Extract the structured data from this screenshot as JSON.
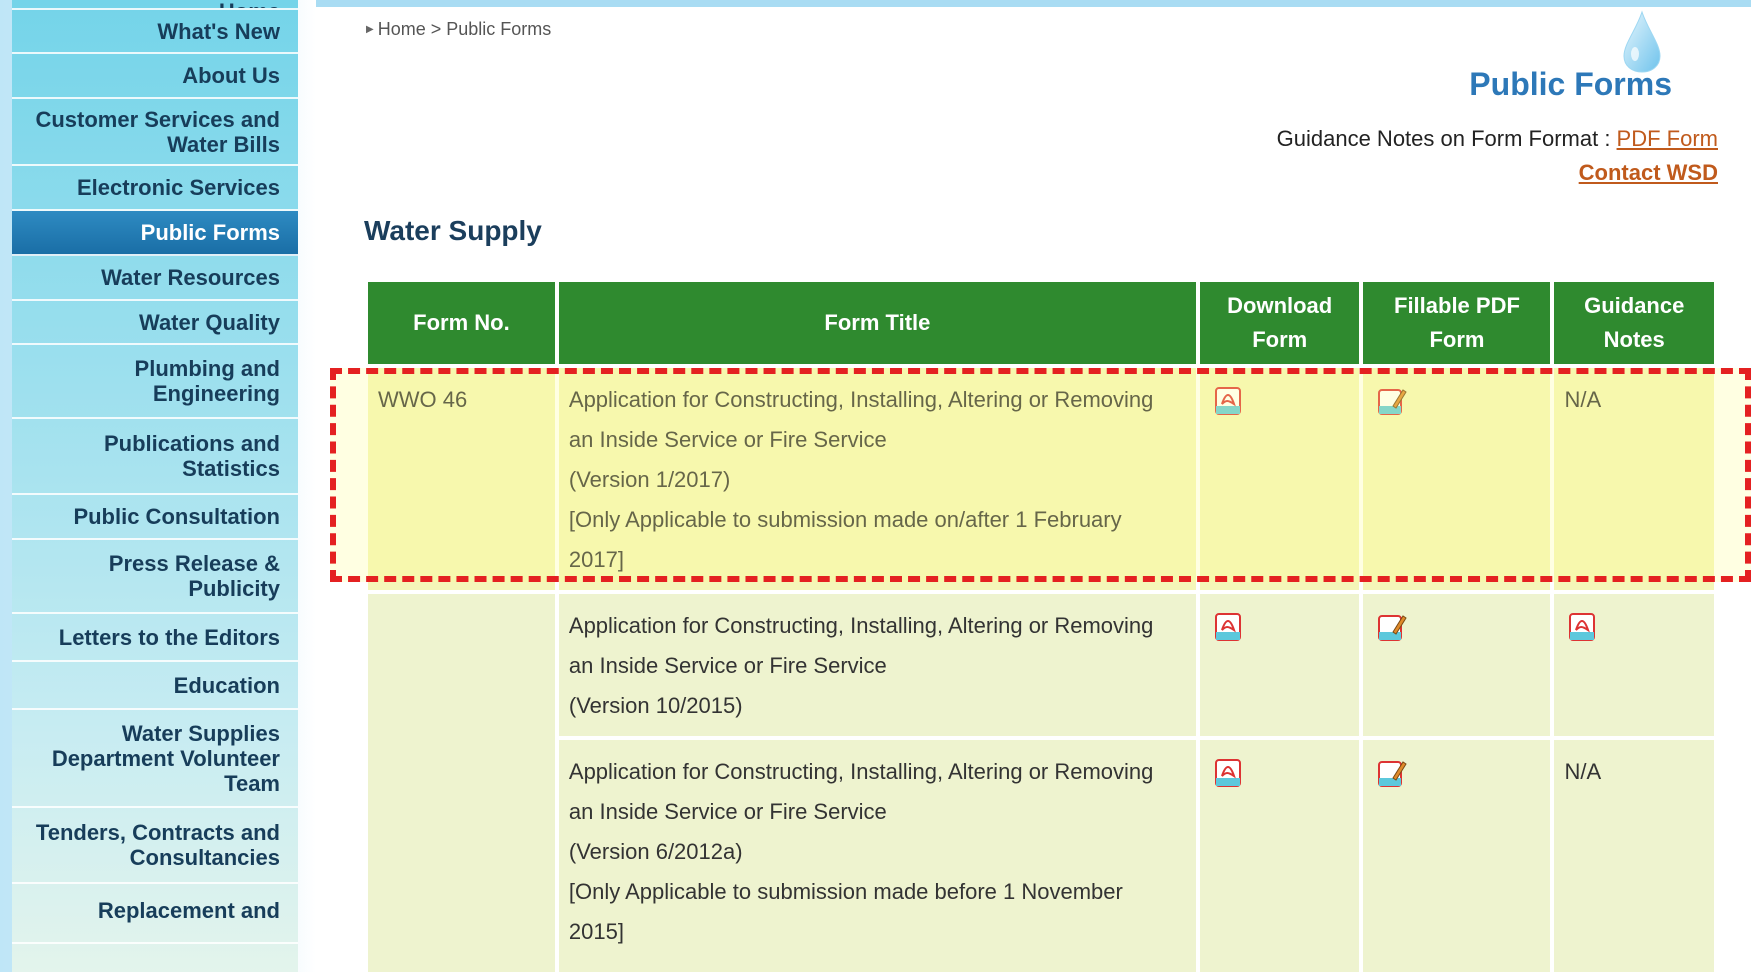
{
  "breadcrumb": {
    "home": "Home",
    "separator": ">",
    "current": "Public Forms"
  },
  "page_title": "Public Forms",
  "guidance": {
    "label": "Guidance Notes on Form Format : ",
    "pdf_link": "PDF Form",
    "contact_link": "Contact WSD"
  },
  "section_title": "Water Supply",
  "sidebar": {
    "items": [
      {
        "label": "Home"
      },
      {
        "label": "What's New"
      },
      {
        "label": "About Us"
      },
      {
        "label": "Customer Services and Water Bills"
      },
      {
        "label": "Electronic Services"
      },
      {
        "label": "Public Forms",
        "active": true
      },
      {
        "label": "Water Resources"
      },
      {
        "label": "Water Quality"
      },
      {
        "label": "Plumbing and Engineering"
      },
      {
        "label": "Publications and Statistics"
      },
      {
        "label": "Public Consultation"
      },
      {
        "label": "Press Release & Publicity"
      },
      {
        "label": "Letters to the Editors"
      },
      {
        "label": "Education"
      },
      {
        "label": "Water Supplies Department Volunteer Team"
      },
      {
        "label": "Tenders, Contracts and Consultancies"
      },
      {
        "label": "Replacement and"
      }
    ]
  },
  "table": {
    "headers": {
      "form_no": "Form No.",
      "form_title": "Form Title",
      "download_l1": "Download",
      "download_l2": "Form",
      "fillable_l1": "Fillable PDF",
      "fillable_l2": "Form",
      "guidance_l1": "Guidance",
      "guidance_l2": "Notes"
    },
    "rows": [
      {
        "form_no": "WWO 46",
        "title_lines": [
          "Application for Constructing, Installing, Altering or Removing",
          "an Inside Service or Fire Service",
          "(Version 1/2017)",
          "[Only Applicable to submission made on/after 1 February",
          "2017]"
        ],
        "guidance": "N/A"
      },
      {
        "form_no": "",
        "title_lines": [
          "Application for Constructing, Installing, Altering or Removing",
          "an Inside Service or Fire Service",
          "(Version 10/2015)"
        ],
        "guidance": ""
      },
      {
        "form_no": "",
        "title_lines": [
          "Application for Constructing, Installing, Altering or Removing",
          "an Inside Service or Fire Service",
          "(Version 6/2012a)",
          "[Only Applicable to submission made before 1 November",
          "2015]"
        ],
        "guidance": "N/A"
      }
    ]
  },
  "icons": {
    "download": "pdf-icon",
    "fillable": "fillable-pdf-icon",
    "guidance_row2": "pdf-icon"
  },
  "colors": {
    "header_green": "#2f8a2f",
    "title_blue": "#2d78b8",
    "link_orange": "#c05a1c",
    "active_nav": "#1f77b0",
    "highlight_red": "#e42121"
  }
}
